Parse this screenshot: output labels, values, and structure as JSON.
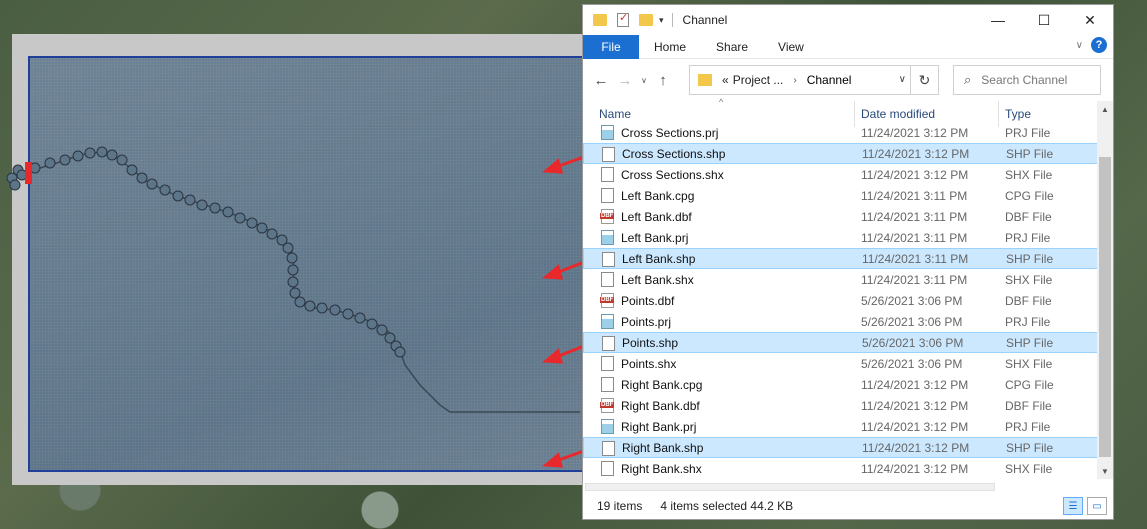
{
  "window": {
    "title": "Channel",
    "minimize": "—",
    "maximize": "☐",
    "close": "✕"
  },
  "ribbon": {
    "file": "File",
    "tabs": [
      "Home",
      "Share",
      "View"
    ],
    "help": "?",
    "expand": "∨"
  },
  "address": {
    "prefix": "«",
    "crumbs": [
      "Project ...",
      "Channel"
    ],
    "separator": "›",
    "back": "←",
    "forward": "→",
    "recent": "∨",
    "up": "↑",
    "dropdown": "∨",
    "refresh": "↻"
  },
  "search": {
    "placeholder": "Search Channel",
    "icon": "⌕"
  },
  "columns": {
    "name": "Name",
    "date": "Date modified",
    "type": "Type"
  },
  "files": [
    {
      "name": "Cross Sections.prj",
      "date": "11/24/2021 3:12 PM",
      "type": "PRJ File",
      "icon": "prj",
      "selected": false
    },
    {
      "name": "Cross Sections.shp",
      "date": "11/24/2021 3:12 PM",
      "type": "SHP File",
      "icon": "doc",
      "selected": true
    },
    {
      "name": "Cross Sections.shx",
      "date": "11/24/2021 3:12 PM",
      "type": "SHX File",
      "icon": "doc",
      "selected": false
    },
    {
      "name": "Left Bank.cpg",
      "date": "11/24/2021 3:11 PM",
      "type": "CPG File",
      "icon": "doc",
      "selected": false
    },
    {
      "name": "Left Bank.dbf",
      "date": "11/24/2021 3:11 PM",
      "type": "DBF File",
      "icon": "dbf",
      "selected": false
    },
    {
      "name": "Left Bank.prj",
      "date": "11/24/2021 3:11 PM",
      "type": "PRJ File",
      "icon": "prj",
      "selected": false
    },
    {
      "name": "Left Bank.shp",
      "date": "11/24/2021 3:11 PM",
      "type": "SHP File",
      "icon": "doc",
      "selected": true
    },
    {
      "name": "Left Bank.shx",
      "date": "11/24/2021 3:11 PM",
      "type": "SHX File",
      "icon": "doc",
      "selected": false
    },
    {
      "name": "Points.dbf",
      "date": "5/26/2021 3:06 PM",
      "type": "DBF File",
      "icon": "dbf",
      "selected": false
    },
    {
      "name": "Points.prj",
      "date": "5/26/2021 3:06 PM",
      "type": "PRJ File",
      "icon": "prj",
      "selected": false
    },
    {
      "name": "Points.shp",
      "date": "5/26/2021 3:06 PM",
      "type": "SHP File",
      "icon": "doc",
      "selected": true
    },
    {
      "name": "Points.shx",
      "date": "5/26/2021 3:06 PM",
      "type": "SHX File",
      "icon": "doc",
      "selected": false
    },
    {
      "name": "Right Bank.cpg",
      "date": "11/24/2021 3:12 PM",
      "type": "CPG File",
      "icon": "doc",
      "selected": false
    },
    {
      "name": "Right Bank.dbf",
      "date": "11/24/2021 3:12 PM",
      "type": "DBF File",
      "icon": "dbf",
      "selected": false
    },
    {
      "name": "Right Bank.prj",
      "date": "11/24/2021 3:12 PM",
      "type": "PRJ File",
      "icon": "prj",
      "selected": false
    },
    {
      "name": "Right Bank.shp",
      "date": "11/24/2021 3:12 PM",
      "type": "SHP File",
      "icon": "doc",
      "selected": true
    },
    {
      "name": "Right Bank.shx",
      "date": "11/24/2021 3:12 PM",
      "type": "SHX File",
      "icon": "doc",
      "selected": false
    }
  ],
  "status": {
    "count": "19 items",
    "selection": "4 items selected  44.2 KB"
  },
  "colors": {
    "accent": "#1a6fd0",
    "selection": "#cce8ff",
    "arrow": "#e8282b"
  }
}
